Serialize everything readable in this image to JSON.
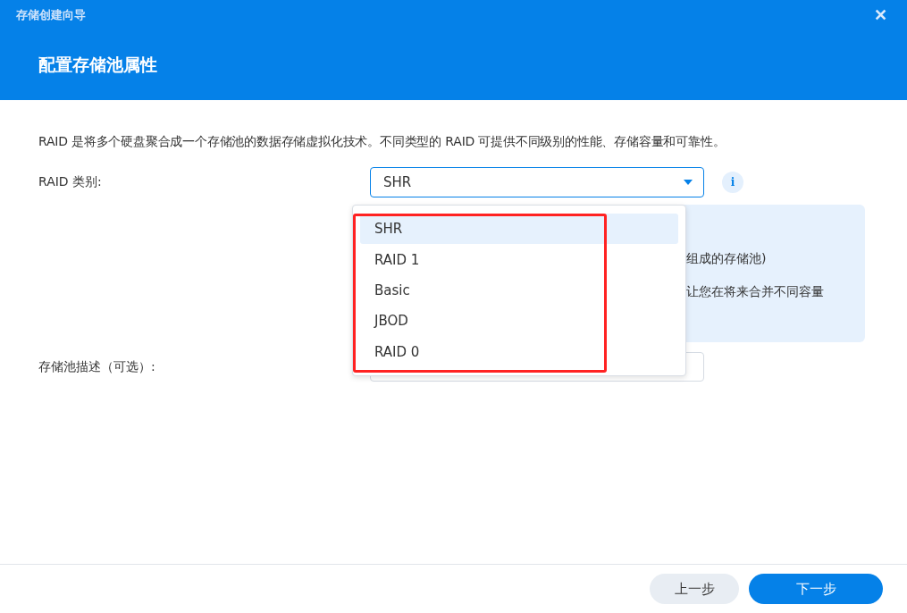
{
  "window": {
    "title": "存储创建向导",
    "close": "✕"
  },
  "heading": "配置存储池属性",
  "description": "RAID 是将多个硬盘聚合成一个存储池的数据存储虚拟化技术。不同类型的 RAID 可提供不同级别的性能、存储容量和可靠性。",
  "raid_type": {
    "label": "RAID 类别:",
    "value": "SHR",
    "expanded": true,
    "info": "i",
    "options": [
      {
        "label": "SHR",
        "selected": true
      },
      {
        "label": "RAID 1",
        "selected": false
      },
      {
        "label": "Basic",
        "selected": false
      },
      {
        "label": "JBOD",
        "selected": false
      },
      {
        "label": "RAID 0",
        "selected": false
      }
    ]
  },
  "info_box": {
    "lines": [
      "组成的存储池)",
      "让您在将来合并不同容量"
    ]
  },
  "pool_description": {
    "label": "存储池描述（可选）:"
  },
  "buttons": [
    {
      "label": "上一步",
      "kind": "secondary"
    },
    {
      "label": "下一步",
      "kind": "primary"
    }
  ]
}
